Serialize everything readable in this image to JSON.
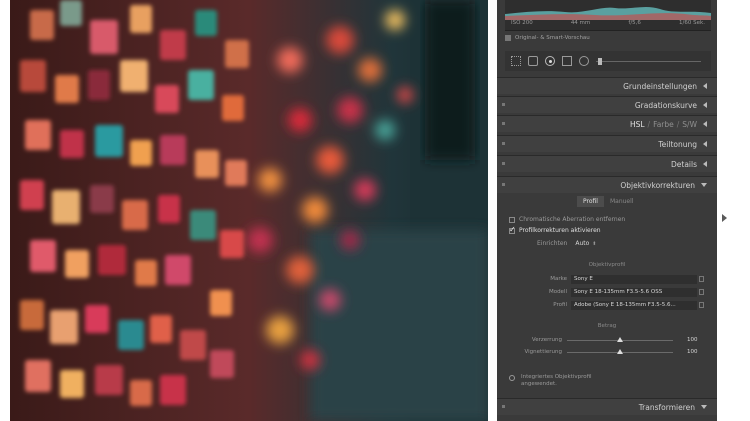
{
  "histogram": {
    "readout": [
      "ISO 200",
      "44 mm",
      "f/5,6",
      "1/60 Sek."
    ]
  },
  "preview": {
    "label": "Original- & Smart-Vorschau"
  },
  "sections": [
    {
      "label": "Grundeinstellungen"
    },
    {
      "label": "Gradationskurve"
    },
    {
      "label": "Teiltonung"
    },
    {
      "label": "Details"
    }
  ],
  "hsl": {
    "parts": [
      "HSL",
      "Farbe",
      "S/W"
    ]
  },
  "lens": {
    "title": "Objektivkorrekturen",
    "tabs": [
      "Profil",
      "Manuell"
    ],
    "remove_ca": "Chromatische Aberration entfernen",
    "enable_profile": "Profilkorrekturen aktivieren",
    "setup_label": "Einrichten",
    "setup_value": "Auto",
    "profile_group": "Objektivprofil",
    "make_label": "Marke",
    "make_value": "Sony E",
    "model_label": "Modell",
    "model_value": "Sony E 18-135mm F3.5-5.6 OSS",
    "profile_label": "Profil",
    "profile_value": "Adobe (Sony E 18-135mm F3.5-5.6...",
    "amount_group": "Betrag",
    "distortion_label": "Verzerrung",
    "distortion_value": "100",
    "vignetting_label": "Vignettierung",
    "vignetting_value": "100",
    "distortion_level": 0.5,
    "vignetting_level": 0.5,
    "info_line1": "Integriertes Objektivprofil",
    "info_line2": "angewendet."
  },
  "transform": {
    "label": "Transformieren"
  },
  "colors": {
    "panel": "#3a3a3a",
    "header": "#404040",
    "text": "#c8c8c8"
  }
}
